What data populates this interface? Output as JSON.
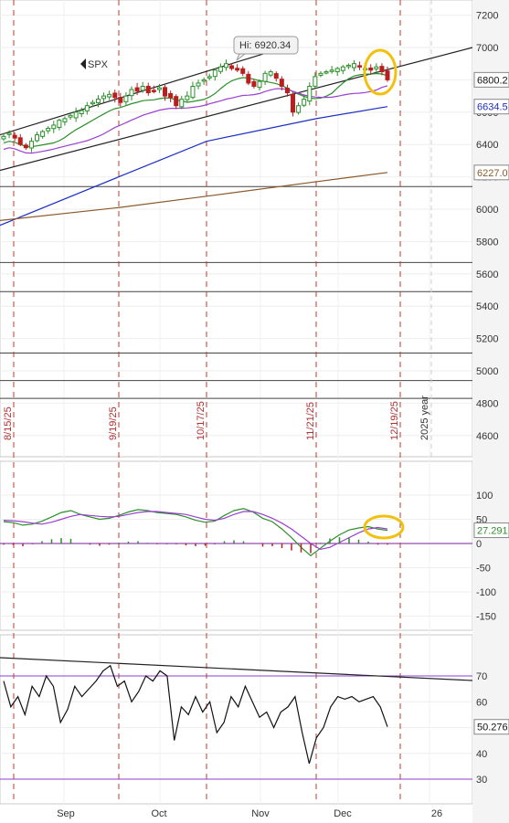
{
  "chart": {
    "symbol": "SPX",
    "hi_label": "Hi: 6920.34",
    "year_marker": "2025 year",
    "price_ticks": [
      "7200",
      "7000",
      "6800",
      "6600",
      "6400",
      "6200",
      "6000",
      "5800",
      "5600",
      "5400",
      "5200",
      "5000",
      "4800",
      "4600"
    ],
    "macd_ticks": [
      "100",
      "50",
      "0",
      "-50",
      "-100",
      "-150"
    ],
    "rsi_ticks": [
      "70",
      "60",
      "50",
      "40",
      "30"
    ],
    "date_markers": [
      "8/15/25",
      "9/19/25",
      "10/17/25",
      "11/21/25",
      "12/19/25"
    ],
    "month_labels": [
      "Sep",
      "Oct",
      "Nov",
      "Dec",
      "26"
    ],
    "tags": {
      "price": "6800.2",
      "ma_blue": "6634.5",
      "ma_brown": "6227.0",
      "macd": "27.291",
      "rsi": "50.276"
    },
    "colors": {
      "candle_up": "#2a8f2a",
      "candle_down": "#b81f1f",
      "ma_green": "#2a8f2a",
      "ma_purple": "#9a3fd0",
      "ma_blue": "#1c2fc4",
      "ma_brown": "#8a5a2a",
      "date_line": "#c0392b",
      "highlight": "#f2c10f"
    }
  },
  "chart_data": [
    {
      "type": "candlestick",
      "ylim": [
        4500,
        7250
      ],
      "series": [
        {
          "values": [
            6450,
            6470,
            6440,
            6400,
            6380,
            6420,
            6460,
            6480,
            6500,
            6520,
            6550,
            6560,
            6580,
            6600,
            6610,
            6640,
            6660,
            6680,
            6700,
            6710,
            6690,
            6660,
            6700,
            6740,
            6730,
            6760,
            6720,
            6730,
            6750,
            6700,
            6690,
            6640,
            6680,
            6700,
            6760,
            6780,
            6800,
            6820,
            6860,
            6880,
            6900,
            6870,
            6860,
            6840,
            6780,
            6760,
            6790,
            6840,
            6850,
            6810,
            6760,
            6720,
            6600,
            6640,
            6680,
            6760,
            6820,
            6840,
            6850,
            6860,
            6870,
            6880,
            6890,
            6900,
            6880,
            6870,
            6860,
            6880,
            6850,
            6800
          ]
        },
        {
          "name": "",
          "values": []
        }
      ],
      "overlays": {
        "hi": 6920.34,
        "last": 6800.2,
        "ma_blue_last": 6634.5,
        "ma_brown_last": 6227.0,
        "horizontal_levels": [
          6140,
          5670,
          5490,
          5110,
          4940,
          4830
        ]
      }
    },
    {
      "type": "line",
      "ylim": [
        -175,
        125
      ],
      "series": [
        {
          "values": [
            45,
            43,
            38,
            40,
            46,
            55,
            64,
            68,
            60,
            55,
            50,
            52,
            58,
            65,
            70,
            68,
            64,
            62,
            60,
            55,
            48,
            44,
            46,
            58,
            68,
            72,
            65,
            52,
            45,
            30,
            12,
            -8,
            -25,
            -10,
            5,
            18,
            28,
            32,
            35,
            30,
            27
          ]
        },
        {
          "values": [
            48,
            47,
            45,
            42,
            40,
            44,
            50,
            56,
            60,
            58,
            56,
            55,
            56,
            60,
            64,
            66,
            66,
            64,
            62,
            60,
            55,
            50,
            48,
            52,
            60,
            66,
            66,
            60,
            52,
            42,
            30,
            15,
            0,
            -12,
            -8,
            2,
            12,
            22,
            30,
            33,
            30
          ]
        }
      ],
      "last": 27.291
    },
    {
      "type": "line",
      "ylim": [
        25,
        75
      ],
      "series": [
        {
          "values": [
            68,
            58,
            62,
            55,
            66,
            62,
            70,
            66,
            52,
            57,
            66,
            62,
            65,
            68,
            72,
            74,
            66,
            68,
            60,
            64,
            70,
            68,
            72,
            70,
            45,
            58,
            55,
            62,
            56,
            60,
            48,
            52,
            62,
            58,
            66,
            60,
            54,
            56,
            50,
            56,
            58,
            62,
            48,
            36,
            46,
            50,
            58,
            62,
            61,
            62,
            60,
            61,
            62,
            58,
            50.276
          ]
        }
      ],
      "last": 50.276,
      "levels": [
        70,
        30
      ]
    }
  ]
}
